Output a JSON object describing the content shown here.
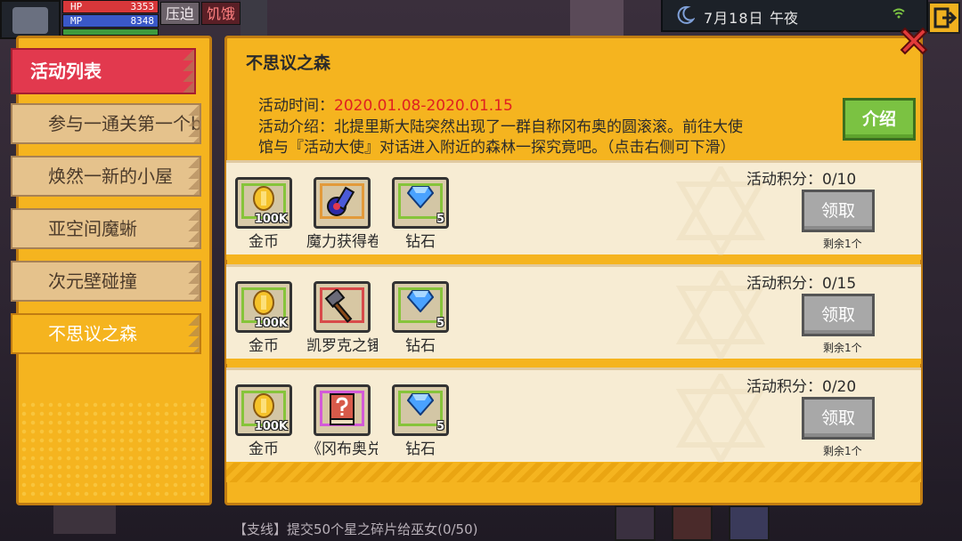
{
  "hud": {
    "hp_label": "HP",
    "hp_value": "3353",
    "mp_label": "MP",
    "mp_value": "8348",
    "status_oppress": "压迫",
    "status_hunger": "饥饿"
  },
  "clock": {
    "date": "7月18日",
    "time": "午夜"
  },
  "menu": {
    "title": "活动列表",
    "items": [
      {
        "label": "参与一通关第一个b"
      },
      {
        "label": "焕然一新的小屋"
      },
      {
        "label": "亚空间魔蜥"
      },
      {
        "label": "次元壁碰撞"
      },
      {
        "label": "不思议之森"
      }
    ]
  },
  "event": {
    "title": "不思议之森",
    "time_label": "活动时间：",
    "time_value": "2020.01.08-2020.01.15",
    "desc_line1": "活动介绍：北提里斯大陆突然出现了一群自称冈布奥的圆滚滚。前往大使",
    "desc_line2": "馆与『活动大使』对话进入附近的森林一探究竟吧。（点击右侧可下滑）",
    "intro_button": "介绍"
  },
  "rewards": [
    {
      "points": "活动积分：0/10",
      "claim": "领取",
      "remaining": "剩余1个",
      "items": [
        {
          "name": "金币",
          "qty": "100K",
          "icon": "gold-coin-icon"
        },
        {
          "name": "魔力获得卷轴",
          "qty": "",
          "icon": "scroll-icon"
        },
        {
          "name": "钻石",
          "qty": "5",
          "icon": "diamond-icon"
        }
      ]
    },
    {
      "points": "活动积分：0/15",
      "claim": "领取",
      "remaining": "剩余1个",
      "items": [
        {
          "name": "金币",
          "qty": "100K",
          "icon": "gold-coin-icon"
        },
        {
          "name": "凯罗克之锤",
          "qty": "",
          "icon": "hammer-icon"
        },
        {
          "name": "钻石",
          "qty": "5",
          "icon": "diamond-icon"
        }
      ]
    },
    {
      "points": "活动积分：0/20",
      "claim": "领取",
      "remaining": "剩余1个",
      "items": [
        {
          "name": "金币",
          "qty": "100K",
          "icon": "gold-coin-icon"
        },
        {
          "name": "《冈布奥兑",
          "qty": "",
          "icon": "mystery-book-icon"
        },
        {
          "name": "钻石",
          "qty": "5",
          "icon": "diamond-icon"
        }
      ]
    }
  ],
  "quest": {
    "text": "【支线】提交50个星之碎片给巫女(0/50)"
  },
  "colors": {
    "panel": "#f5b41f",
    "active_tab": "#e2394e",
    "intro_button": "#7bc242",
    "claim_button_disabled": "#a8a8a8",
    "time_red": "#e02020"
  }
}
